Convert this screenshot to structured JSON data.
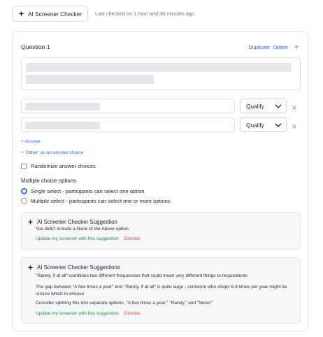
{
  "topbar": {
    "checker_button": "AI Screener Checker",
    "last_checked": "Last checked on 1 hour and 30 minutes ago"
  },
  "question": {
    "title": "Question 1",
    "duplicate": "Duplicate",
    "delete": "Delete",
    "answers": [
      {
        "qualifier": "Qualify"
      },
      {
        "qualifier": "Qualify"
      }
    ],
    "add_answer": "+ Answer",
    "add_other": "+ 'Other' as an answer choice",
    "randomize_label": "Randomize answer choices",
    "mc_heading": "Multiple choice options",
    "single_select": "Single select - participants can select one option",
    "multiple_select": "Multiple select - participants can select one or more options"
  },
  "suggestion1": {
    "title": "AI Screener Checker Suggestion",
    "text": "You didn't include a None of the Above option.",
    "update": "Update my screener with this suggestion",
    "dismiss": "Dismiss"
  },
  "suggestion2": {
    "title": "AI Screener Checker Suggestions",
    "line1": "\"Rarely, if at all\" combines two different frequencies that could mean very different things to respondents",
    "line2": "The gap between \"A few times a year\" and \"Rarely, if at all\" is quite large - someone who shops 6-8 times per year might be unsure which to choose",
    "line3": "Consider splitting this into separate options: \"A few times a year,\" \"Rarely,\" and \"Never\"",
    "update": "Update my screener with this suggestion",
    "dismiss": "Dismiss"
  },
  "colors": {
    "link": "#2f6fe0",
    "update": "#2e8b3e",
    "dismiss": "#d23b3b"
  }
}
